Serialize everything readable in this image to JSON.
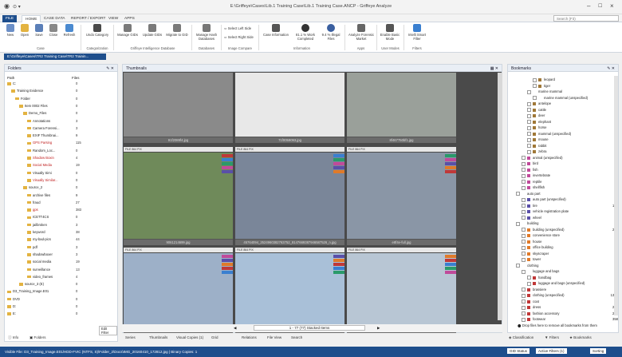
{
  "window": {
    "title": "E:\\Griffeye\\Cases\\Lib.1 Training Case\\Lib.1 Training Case.ANCP - Griffeye Analyze"
  },
  "menu": {
    "file": "FILE",
    "tabs": [
      "HOME",
      "CASE DATA",
      "REPORT / EXPORT",
      "VIEW",
      "APPS"
    ],
    "search_placeholder": "Search (F3)"
  },
  "ribbon": {
    "buttons": [
      {
        "label": "New",
        "color": "#6b8fc7"
      },
      {
        "label": "Open",
        "color": "#e3b341"
      },
      {
        "label": "Save",
        "color": "#5b7fb8"
      },
      {
        "label": "Close",
        "color": "#888"
      },
      {
        "label": "Refresh",
        "color": "#4a8ad0"
      },
      {
        "label": "Undo Category",
        "color": "#4a4a4a"
      },
      {
        "label": "Manage GIDs",
        "color": "#7a7a7a"
      },
      {
        "label": "Update GIDs",
        "color": "#7a7a7a"
      },
      {
        "label": "Migrate to GID",
        "color": "#7a7a7a"
      },
      {
        "label": "Manage Hash Databases",
        "color": "#777"
      },
      {
        "label": "Case Information",
        "color": "#555"
      },
      {
        "label": "81.1 % Work Completed",
        "color": "#333"
      },
      {
        "label": "9.4 % Illegal Files",
        "color": "#3a5fa0"
      },
      {
        "label": "Analyze Forensic Market",
        "color": "#666"
      },
      {
        "label": "Enable Basic Mode",
        "color": "#555"
      },
      {
        "label": "Intelli Smart Filter",
        "color": "#3a7fd0"
      }
    ],
    "small": [
      "Select Left Side",
      "Select Right Side"
    ],
    "groups": [
      "Case",
      "Categorization",
      "Griffeye Intelligence Database",
      "Databases",
      "Image Compare",
      "Information",
      "Apps",
      "User Modes",
      "Filters"
    ]
  },
  "doc_tab": "E:\\Griffeye\\Cases\\TR2 Training Case\\TR2 Trainin...",
  "folders": {
    "title": "Folders",
    "col_path": "Path",
    "col_files": "Files",
    "rows": [
      {
        "name": "C:",
        "d": 0,
        "v": "0"
      },
      {
        "name": "Training Evidence",
        "d": 1,
        "v": "0"
      },
      {
        "name": "Folder",
        "d": 2,
        "v": "0"
      },
      {
        "name": "Item 0002 Files",
        "d": 3,
        "v": "0"
      },
      {
        "name": "Demo_Files",
        "d": 4,
        "v": "0"
      },
      {
        "name": "Annotations",
        "d": 5,
        "v": "3"
      },
      {
        "name": "Camera Forensi...",
        "d": 5,
        "v": "3"
      },
      {
        "name": "EXIF Thumbnai...",
        "d": 5,
        "v": "9"
      },
      {
        "name": "GPS Parsing",
        "d": 5,
        "v": "115",
        "red": true
      },
      {
        "name": "Random_Loc...",
        "d": 5,
        "v": "0"
      },
      {
        "name": "Shadow Boxin",
        "d": 5,
        "v": "4",
        "red": true
      },
      {
        "name": "Social Media",
        "d": 5,
        "v": "19",
        "red": true
      },
      {
        "name": "Visually Simi",
        "d": 5,
        "v": "0"
      },
      {
        "name": "Visually Similar...",
        "d": 5,
        "v": "0",
        "red": true
      },
      {
        "name": "source_2",
        "d": 4,
        "v": "0"
      },
      {
        "name": "archive files",
        "d": 5,
        "v": "9"
      },
      {
        "name": "fraud",
        "d": 5,
        "v": "27"
      },
      {
        "name": "gps",
        "d": 5,
        "v": "383",
        "red": true
      },
      {
        "name": "ICETT4CS",
        "d": 5,
        "v": "0"
      },
      {
        "name": "jailbroken",
        "d": 5,
        "v": "3"
      },
      {
        "name": "keyword",
        "d": 5,
        "v": "38"
      },
      {
        "name": "my-bad-pics",
        "d": 5,
        "v": "44"
      },
      {
        "name": "pdf",
        "d": 5,
        "v": "3"
      },
      {
        "name": "shadowboxer",
        "d": 5,
        "v": "3"
      },
      {
        "name": "social media",
        "d": 5,
        "v": "19"
      },
      {
        "name": "surveillance",
        "d": 5,
        "v": "13"
      },
      {
        "name": "video_frames",
        "d": 5,
        "v": "4"
      },
      {
        "name": "source_3 (E)",
        "d": 3,
        "v": "0"
      },
      {
        "name": "D3_Training_Image.E01",
        "d": 0,
        "v": "0"
      },
      {
        "name": "DVD",
        "d": 0,
        "v": "0"
      },
      {
        "name": "D:",
        "d": 0,
        "v": "0"
      },
      {
        "name": "E:",
        "d": 0,
        "v": "0"
      }
    ],
    "edit_filter": "Edit Filter",
    "bottom_tabs": [
      "Info",
      "Folders"
    ]
  },
  "thumbnails": {
    "title": "Thumbnails",
    "bar_label": "FILE 864 PIX",
    "items": [
      {
        "cap": "91f2089f4.jpg",
        "bg": "#8a8a8a"
      },
      {
        "cap": "71f0059093.jpg",
        "bg": "#e8e8e8"
      },
      {
        "cap": "8f467750bf1.jpg",
        "bg": "#9aa09a"
      },
      {
        "cap": "9061214699.jpg",
        "bg": "#6f8a5a"
      },
      {
        "cap": "45764094_2524960382763752_8147669387946587526_n.jpg",
        "bg": "#7a8699"
      },
      {
        "cap": "e8f4e-full.jpg",
        "bg": "#8a96a6"
      },
      {
        "cap": "",
        "bg": "#9db0c8"
      },
      {
        "cap": "",
        "bg": "#a9c0d8"
      },
      {
        "cap": "",
        "bg": "#b8c6d4"
      }
    ],
    "pager": "1 - 77 (77) Stacked Items",
    "bottom_tabs": [
      "Series",
      "Thumbnails",
      "Visual Copies (1)",
      "Grid",
      "Relations",
      "File View",
      "Search"
    ]
  },
  "bookmarks": {
    "title": "Bookmarks",
    "rows": [
      {
        "label": "leopard",
        "c": "13",
        "sw": "#a07838",
        "d": 3
      },
      {
        "label": "tiger",
        "c": "4",
        "sw": "#a07838",
        "d": 3
      },
      {
        "label": "marine mammal",
        "c": "",
        "sw": "#fff",
        "d": 2
      },
      {
        "label": "marine mammal (unspecified)",
        "c": "",
        "sw": "#fff",
        "d": 3
      },
      {
        "label": "antelope",
        "c": "4",
        "sw": "#a07838",
        "d": 2
      },
      {
        "label": "cattle",
        "c": "4",
        "sw": "#a07838",
        "d": 2
      },
      {
        "label": "deer",
        "c": "12",
        "sw": "#a07838",
        "d": 2
      },
      {
        "label": "elephant",
        "c": "2",
        "sw": "#a07838",
        "d": 2
      },
      {
        "label": "horse",
        "c": "11",
        "sw": "#a07838",
        "d": 2
      },
      {
        "label": "mammal (unspecified)",
        "c": "87",
        "sw": "#a07838",
        "d": 2
      },
      {
        "label": "mouse",
        "c": "1",
        "sw": "#a07838",
        "d": 2
      },
      {
        "label": "rabbit",
        "c": "1",
        "sw": "#a07838",
        "d": 2
      },
      {
        "label": "zebra",
        "c": "1",
        "sw": "#a07838",
        "d": 2
      },
      {
        "label": "animal (unspecified)",
        "c": "6",
        "sw": "#c04a9a",
        "d": 1
      },
      {
        "label": "bird",
        "c": "17",
        "sw": "#c04a9a",
        "d": 1
      },
      {
        "label": "fish",
        "c": "8",
        "sw": "#c04a9a",
        "d": 1
      },
      {
        "label": "invertebrate",
        "c": "17",
        "sw": "#c04a9a",
        "d": 1
      },
      {
        "label": "reptile",
        "c": "5",
        "sw": "#c04a9a",
        "d": 1
      },
      {
        "label": "shellfish",
        "c": "1",
        "sw": "#c04a9a",
        "d": 1
      },
      {
        "label": "auto part",
        "c": "",
        "sw": "#fff",
        "d": 0
      },
      {
        "label": "auto part (unspecified)",
        "c": "11",
        "sw": "#5a4fa8",
        "d": 1
      },
      {
        "label": "tire",
        "c": "122",
        "sw": "#5a4fa8",
        "d": 1
      },
      {
        "label": "vehicle registration plate",
        "c": "30",
        "sw": "#5a4fa8",
        "d": 1
      },
      {
        "label": "wheel",
        "c": "57",
        "sw": "#5a4fa8",
        "d": 1
      },
      {
        "label": "building",
        "c": "",
        "sw": "#fff",
        "d": 0
      },
      {
        "label": "building (unspecified)",
        "c": "298",
        "sw": "#e07a2a",
        "d": 1
      },
      {
        "label": "convenience store",
        "c": "1",
        "sw": "#e07a2a",
        "d": 1
      },
      {
        "label": "house",
        "c": "37",
        "sw": "#e07a2a",
        "d": 1
      },
      {
        "label": "office building",
        "c": "8",
        "sw": "#e07a2a",
        "d": 1
      },
      {
        "label": "skyscraper",
        "c": "48",
        "sw": "#e07a2a",
        "d": 1
      },
      {
        "label": "tower",
        "c": "22",
        "sw": "#e07a2a",
        "d": 1
      },
      {
        "label": "clothing",
        "c": "",
        "sw": "#fff",
        "d": 0
      },
      {
        "label": "luggage and bags",
        "c": "",
        "sw": "#fff",
        "d": 1
      },
      {
        "label": "handbag",
        "c": "1",
        "sw": "#c03838",
        "d": 2
      },
      {
        "label": "luggage and bags (unspecified)",
        "c": "3",
        "sw": "#c03838",
        "d": 2
      },
      {
        "label": "brassiere",
        "c": "17",
        "sw": "#c03838",
        "d": 1
      },
      {
        "label": "clothing (unspecified)",
        "c": "1318",
        "sw": "#c03838",
        "d": 1
      },
      {
        "label": "coat",
        "c": "17",
        "sw": "#c03838",
        "d": 1
      },
      {
        "label": "dress",
        "c": "221",
        "sw": "#c03838",
        "d": 1
      },
      {
        "label": "fashion accessory",
        "c": "210",
        "sw": "#c03838",
        "d": 1
      },
      {
        "label": "footwear",
        "c": "358",
        "sw": "#c03838",
        "d": 1
      }
    ],
    "drop_hint": "Drop files here to remove all bookmarks from them",
    "bottom_tabs": [
      "Classification",
      "Filters",
      "Bookmarks"
    ]
  },
  "status": {
    "left": "Visible File: D3_Training_Image.E01/HDD-FVIC (NTFS, S)\\Folder_2\\Docs\\IMG_20160410_172812.jpg | Binary Copies: 1",
    "gid": "GID Status",
    "filters": "Active Filters (1)",
    "sorting": "Sorting"
  }
}
